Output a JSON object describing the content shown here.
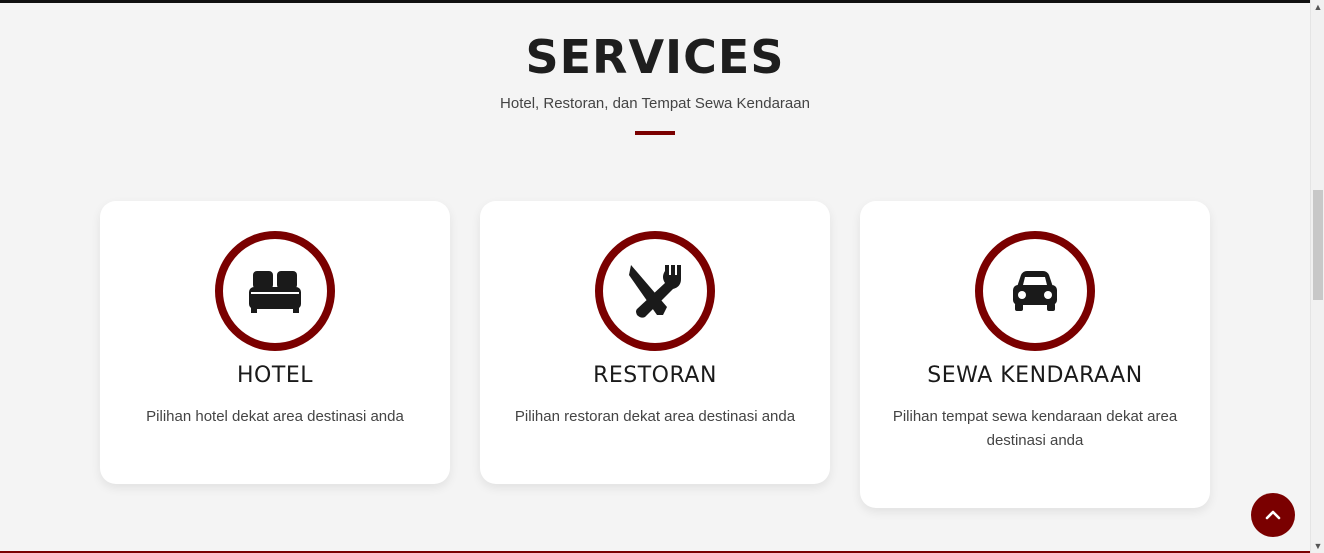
{
  "section": {
    "title": "SERVICES",
    "subtitle": "Hotel, Restoran, dan Tempat Sewa Kendaraan"
  },
  "cards": [
    {
      "icon": "bed-icon",
      "title": "HOTEL",
      "description": "Pilihan hotel dekat area destinasi anda"
    },
    {
      "icon": "utensils-icon",
      "title": "RESTORAN",
      "description": "Pilihan restoran dekat area destinasi anda"
    },
    {
      "icon": "car-icon",
      "title": "SEWA KENDARAAN",
      "description": "Pilihan tempat sewa kendaraan dekat area destinasi anda"
    }
  ],
  "colors": {
    "accent": "#7a0000",
    "background": "#f4f4f4",
    "card": "#ffffff"
  },
  "back_to_top": {
    "icon": "chevron-up-icon"
  }
}
